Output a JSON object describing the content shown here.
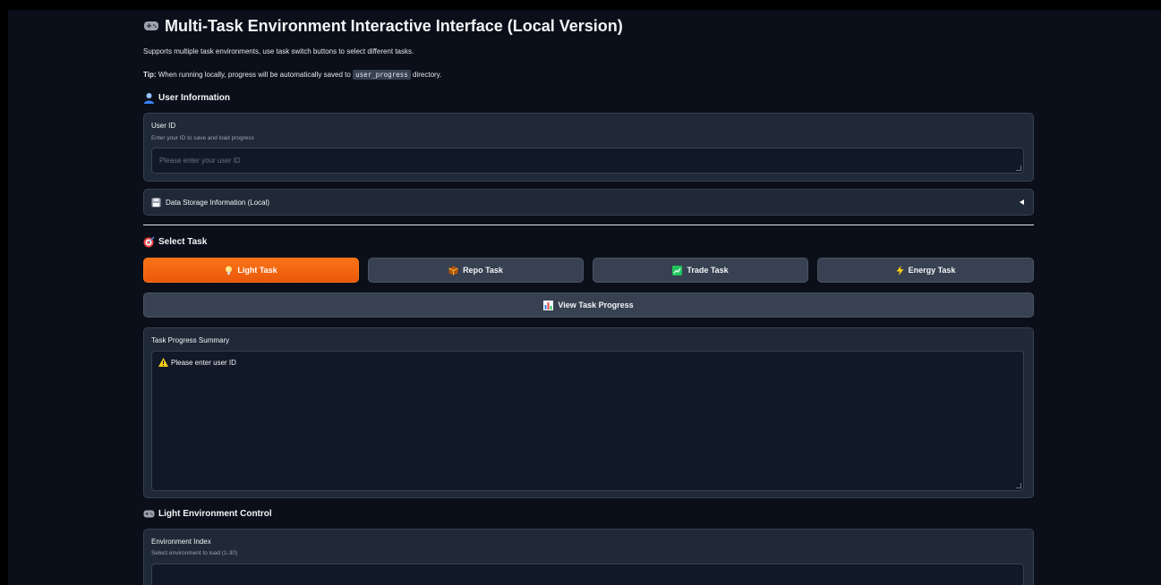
{
  "header": {
    "title": "Multi-Task Environment Interactive Interface (Local Version)",
    "description": "Supports multiple task environments, use task switch buttons to select different tasks.",
    "tip_label": "Tip:",
    "tip_text": "When running locally, progress will be automatically saved to",
    "tip_code": "user_progress",
    "tip_suffix": "directory."
  },
  "user_info": {
    "heading": "User Information",
    "field_label": "User ID",
    "field_info": "Enter your ID to save and load progress",
    "placeholder": "Please enter your user ID",
    "value": ""
  },
  "storage": {
    "label": "Data Storage Information (Local)"
  },
  "select_task": {
    "heading": "Select Task",
    "tabs": [
      {
        "label": "Light Task",
        "icon": "bulb-icon",
        "selected": true
      },
      {
        "label": "Repo Task",
        "icon": "package-icon",
        "selected": false
      },
      {
        "label": "Trade Task",
        "icon": "chart-up-icon",
        "selected": false
      },
      {
        "label": "Energy Task",
        "icon": "lightning-icon",
        "selected": false
      }
    ],
    "view_progress_label": "View Task Progress"
  },
  "progress_summary": {
    "label": "Task Progress Summary",
    "value": "Please enter user ID"
  },
  "light_env": {
    "heading": "Light Environment Control",
    "field_label": "Environment Index",
    "field_info": "Select environment to load (1-30)"
  },
  "colors": {
    "background": "#0b0f19",
    "panel": "#1f2937",
    "accent": "#f97316",
    "button": "#374151"
  }
}
